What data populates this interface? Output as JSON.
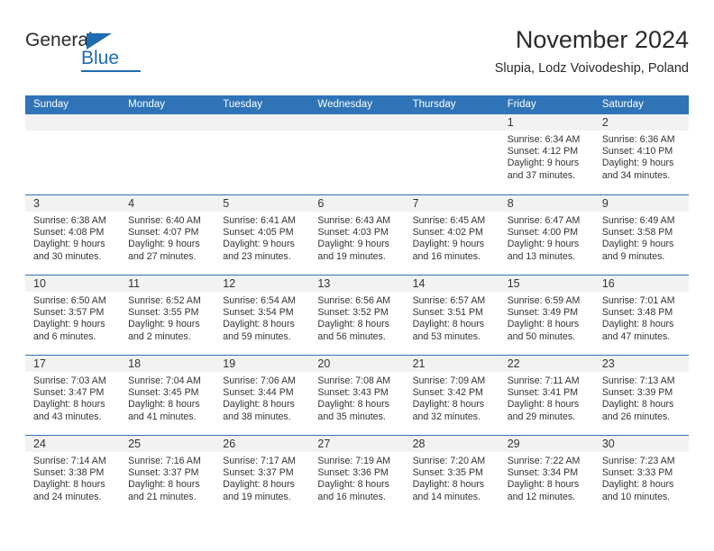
{
  "brand": {
    "name_part1": "General",
    "name_part2": "Blue",
    "triangle_color": "#1f6cb0"
  },
  "header": {
    "title": "November 2024",
    "subtitle": "Slupia, Lodz Voivodeship, Poland",
    "accent_color": "#2f74b7",
    "band_color": "#f2f2f2"
  },
  "weekdays": [
    "Sunday",
    "Monday",
    "Tuesday",
    "Wednesday",
    "Thursday",
    "Friday",
    "Saturday"
  ],
  "weeks": [
    [
      {
        "day": "",
        "sunrise": "",
        "sunset": "",
        "daylight1": "",
        "daylight2": ""
      },
      {
        "day": "",
        "sunrise": "",
        "sunset": "",
        "daylight1": "",
        "daylight2": ""
      },
      {
        "day": "",
        "sunrise": "",
        "sunset": "",
        "daylight1": "",
        "daylight2": ""
      },
      {
        "day": "",
        "sunrise": "",
        "sunset": "",
        "daylight1": "",
        "daylight2": ""
      },
      {
        "day": "",
        "sunrise": "",
        "sunset": "",
        "daylight1": "",
        "daylight2": ""
      },
      {
        "day": "1",
        "sunrise": "Sunrise: 6:34 AM",
        "sunset": "Sunset: 4:12 PM",
        "daylight1": "Daylight: 9 hours",
        "daylight2": "and 37 minutes."
      },
      {
        "day": "2",
        "sunrise": "Sunrise: 6:36 AM",
        "sunset": "Sunset: 4:10 PM",
        "daylight1": "Daylight: 9 hours",
        "daylight2": "and 34 minutes."
      }
    ],
    [
      {
        "day": "3",
        "sunrise": "Sunrise: 6:38 AM",
        "sunset": "Sunset: 4:08 PM",
        "daylight1": "Daylight: 9 hours",
        "daylight2": "and 30 minutes."
      },
      {
        "day": "4",
        "sunrise": "Sunrise: 6:40 AM",
        "sunset": "Sunset: 4:07 PM",
        "daylight1": "Daylight: 9 hours",
        "daylight2": "and 27 minutes."
      },
      {
        "day": "5",
        "sunrise": "Sunrise: 6:41 AM",
        "sunset": "Sunset: 4:05 PM",
        "daylight1": "Daylight: 9 hours",
        "daylight2": "and 23 minutes."
      },
      {
        "day": "6",
        "sunrise": "Sunrise: 6:43 AM",
        "sunset": "Sunset: 4:03 PM",
        "daylight1": "Daylight: 9 hours",
        "daylight2": "and 19 minutes."
      },
      {
        "day": "7",
        "sunrise": "Sunrise: 6:45 AM",
        "sunset": "Sunset: 4:02 PM",
        "daylight1": "Daylight: 9 hours",
        "daylight2": "and 16 minutes."
      },
      {
        "day": "8",
        "sunrise": "Sunrise: 6:47 AM",
        "sunset": "Sunset: 4:00 PM",
        "daylight1": "Daylight: 9 hours",
        "daylight2": "and 13 minutes."
      },
      {
        "day": "9",
        "sunrise": "Sunrise: 6:49 AM",
        "sunset": "Sunset: 3:58 PM",
        "daylight1": "Daylight: 9 hours",
        "daylight2": "and 9 minutes."
      }
    ],
    [
      {
        "day": "10",
        "sunrise": "Sunrise: 6:50 AM",
        "sunset": "Sunset: 3:57 PM",
        "daylight1": "Daylight: 9 hours",
        "daylight2": "and 6 minutes."
      },
      {
        "day": "11",
        "sunrise": "Sunrise: 6:52 AM",
        "sunset": "Sunset: 3:55 PM",
        "daylight1": "Daylight: 9 hours",
        "daylight2": "and 2 minutes."
      },
      {
        "day": "12",
        "sunrise": "Sunrise: 6:54 AM",
        "sunset": "Sunset: 3:54 PM",
        "daylight1": "Daylight: 8 hours",
        "daylight2": "and 59 minutes."
      },
      {
        "day": "13",
        "sunrise": "Sunrise: 6:56 AM",
        "sunset": "Sunset: 3:52 PM",
        "daylight1": "Daylight: 8 hours",
        "daylight2": "and 56 minutes."
      },
      {
        "day": "14",
        "sunrise": "Sunrise: 6:57 AM",
        "sunset": "Sunset: 3:51 PM",
        "daylight1": "Daylight: 8 hours",
        "daylight2": "and 53 minutes."
      },
      {
        "day": "15",
        "sunrise": "Sunrise: 6:59 AM",
        "sunset": "Sunset: 3:49 PM",
        "daylight1": "Daylight: 8 hours",
        "daylight2": "and 50 minutes."
      },
      {
        "day": "16",
        "sunrise": "Sunrise: 7:01 AM",
        "sunset": "Sunset: 3:48 PM",
        "daylight1": "Daylight: 8 hours",
        "daylight2": "and 47 minutes."
      }
    ],
    [
      {
        "day": "17",
        "sunrise": "Sunrise: 7:03 AM",
        "sunset": "Sunset: 3:47 PM",
        "daylight1": "Daylight: 8 hours",
        "daylight2": "and 43 minutes."
      },
      {
        "day": "18",
        "sunrise": "Sunrise: 7:04 AM",
        "sunset": "Sunset: 3:45 PM",
        "daylight1": "Daylight: 8 hours",
        "daylight2": "and 41 minutes."
      },
      {
        "day": "19",
        "sunrise": "Sunrise: 7:06 AM",
        "sunset": "Sunset: 3:44 PM",
        "daylight1": "Daylight: 8 hours",
        "daylight2": "and 38 minutes."
      },
      {
        "day": "20",
        "sunrise": "Sunrise: 7:08 AM",
        "sunset": "Sunset: 3:43 PM",
        "daylight1": "Daylight: 8 hours",
        "daylight2": "and 35 minutes."
      },
      {
        "day": "21",
        "sunrise": "Sunrise: 7:09 AM",
        "sunset": "Sunset: 3:42 PM",
        "daylight1": "Daylight: 8 hours",
        "daylight2": "and 32 minutes."
      },
      {
        "day": "22",
        "sunrise": "Sunrise: 7:11 AM",
        "sunset": "Sunset: 3:41 PM",
        "daylight1": "Daylight: 8 hours",
        "daylight2": "and 29 minutes."
      },
      {
        "day": "23",
        "sunrise": "Sunrise: 7:13 AM",
        "sunset": "Sunset: 3:39 PM",
        "daylight1": "Daylight: 8 hours",
        "daylight2": "and 26 minutes."
      }
    ],
    [
      {
        "day": "24",
        "sunrise": "Sunrise: 7:14 AM",
        "sunset": "Sunset: 3:38 PM",
        "daylight1": "Daylight: 8 hours",
        "daylight2": "and 24 minutes."
      },
      {
        "day": "25",
        "sunrise": "Sunrise: 7:16 AM",
        "sunset": "Sunset: 3:37 PM",
        "daylight1": "Daylight: 8 hours",
        "daylight2": "and 21 minutes."
      },
      {
        "day": "26",
        "sunrise": "Sunrise: 7:17 AM",
        "sunset": "Sunset: 3:37 PM",
        "daylight1": "Daylight: 8 hours",
        "daylight2": "and 19 minutes."
      },
      {
        "day": "27",
        "sunrise": "Sunrise: 7:19 AM",
        "sunset": "Sunset: 3:36 PM",
        "daylight1": "Daylight: 8 hours",
        "daylight2": "and 16 minutes."
      },
      {
        "day": "28",
        "sunrise": "Sunrise: 7:20 AM",
        "sunset": "Sunset: 3:35 PM",
        "daylight1": "Daylight: 8 hours",
        "daylight2": "and 14 minutes."
      },
      {
        "day": "29",
        "sunrise": "Sunrise: 7:22 AM",
        "sunset": "Sunset: 3:34 PM",
        "daylight1": "Daylight: 8 hours",
        "daylight2": "and 12 minutes."
      },
      {
        "day": "30",
        "sunrise": "Sunrise: 7:23 AM",
        "sunset": "Sunset: 3:33 PM",
        "daylight1": "Daylight: 8 hours",
        "daylight2": "and 10 minutes."
      }
    ]
  ]
}
